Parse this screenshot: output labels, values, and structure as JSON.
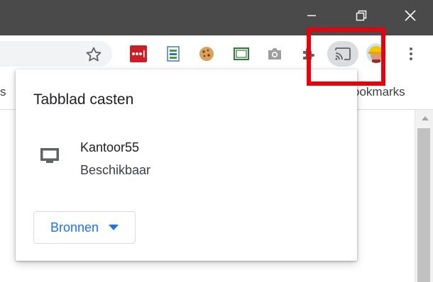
{
  "titlebar": {
    "minimize": "minimize-icon",
    "restore": "restore-icon",
    "close": "close-icon"
  },
  "toolbar": {
    "star": "star-icon",
    "extensions": [
      "lastpass-icon",
      "spreadsheet-icon",
      "cookie-icon",
      "screenshot-crop-icon",
      "camera-icon",
      "puzzle-icon"
    ],
    "cast": "cast-icon",
    "menu": "more-vert-icon"
  },
  "bookmarks": {
    "left_fragment": "s",
    "right_label": "ookmarks"
  },
  "cast_dialog": {
    "title": "Tabblad casten",
    "sink": {
      "icon": "monitor-icon",
      "name": "Kantoor55",
      "status": "Beschikbaar"
    },
    "sources_button": "Bronnen"
  },
  "colors": {
    "titlebar": "#4a4a4a",
    "accent": "#1a73e8",
    "highlight": "#e8000b"
  }
}
